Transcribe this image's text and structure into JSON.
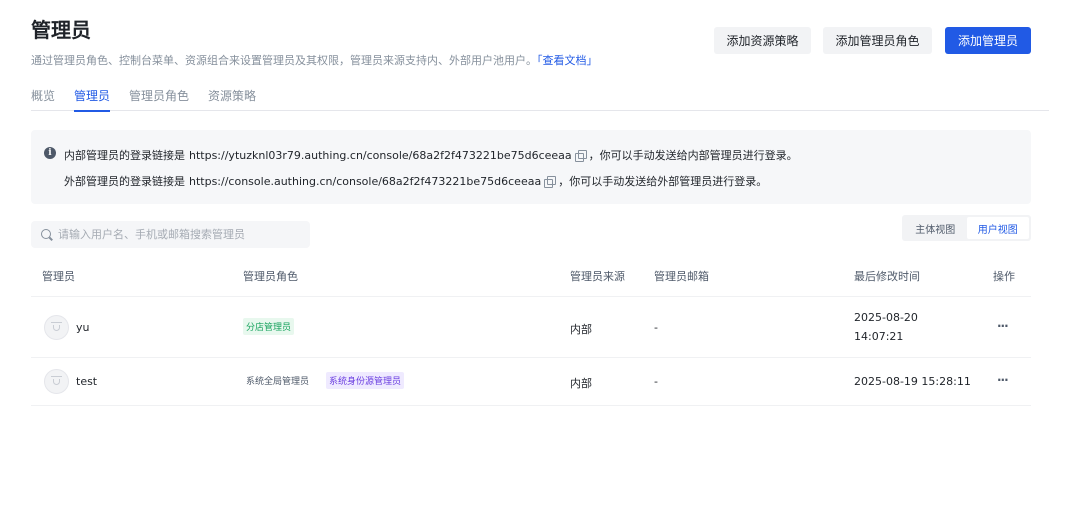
{
  "header": {
    "title": "管理员",
    "description": "通过管理员角色、控制台菜单、资源组合来设置管理员及其权限，管理员来源支持内、外部用户池用户。",
    "doc_link": "「查看文档」",
    "buttons": {
      "add_policy": "添加资源策略",
      "add_role": "添加管理员角色",
      "add_admin": "添加管理员"
    }
  },
  "tabs": [
    "概览",
    "管理员",
    "管理员角色",
    "资源策略"
  ],
  "active_tab": "管理员",
  "info": {
    "internal_prefix": "内部管理员的登录链接是",
    "internal_url": "https://ytuzknl03r79.authing.cn/console/68a2f2f473221be75d6ceeaa",
    "internal_suffix": "，你可以手动发送给内部管理员进行登录。",
    "external_prefix": "外部管理员的登录链接是",
    "external_url": "https://console.authing.cn/console/68a2f2f473221be75d6ceeaa",
    "external_suffix": "，你可以手动发送给外部管理员进行登录。"
  },
  "search": {
    "placeholder": "请输入用户名、手机或邮箱搜索管理员"
  },
  "view_switch": {
    "subject_view": "主体视图",
    "user_view": "用户视图",
    "active": "用户视图"
  },
  "table": {
    "columns": [
      "管理员",
      "管理员角色",
      "管理员来源",
      "管理员邮箱",
      "最后修改时间",
      "操作"
    ],
    "rows": [
      {
        "name": "yu",
        "roles": [
          {
            "label": "分店管理员",
            "style": "green"
          }
        ],
        "source": "内部",
        "email": "-",
        "modified_date": "2025-08-20",
        "modified_time": "14:07:21",
        "actions": "···"
      },
      {
        "name": "test",
        "roles": [
          {
            "label": "系统全局管理员",
            "style": "plain"
          },
          {
            "label": "系统身份源管理员",
            "style": "purple"
          }
        ],
        "source": "内部",
        "email": "-",
        "modified": "2025-08-19 15:28:11",
        "actions": "···"
      }
    ]
  },
  "colors": {
    "primary": "#215ae5",
    "tag_green_text": "#15a25c",
    "tag_purple_text": "#6a3de0"
  }
}
